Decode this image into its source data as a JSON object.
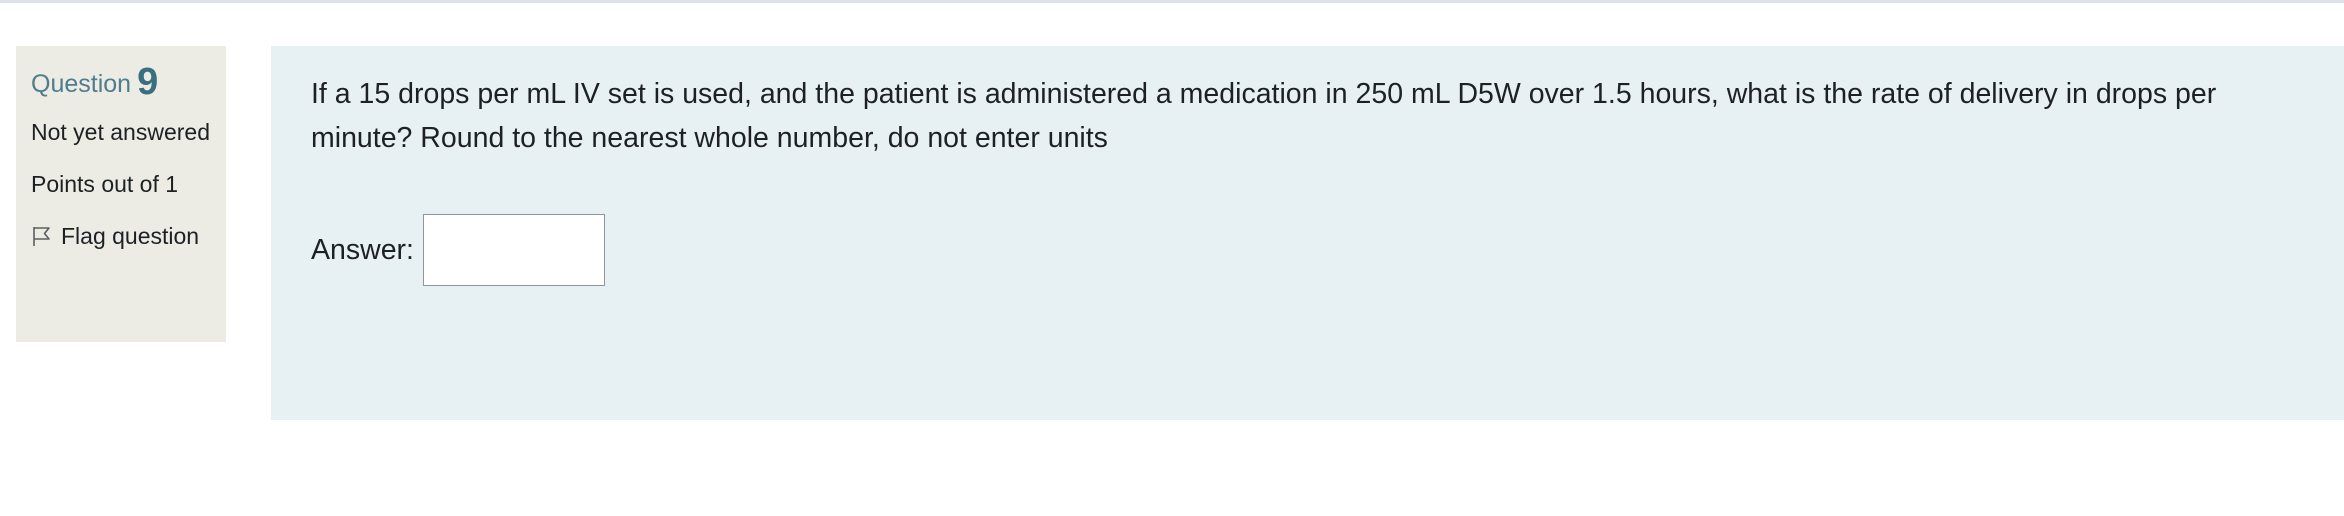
{
  "question_info": {
    "label": "Question",
    "number": "9",
    "state": "Not yet answered",
    "grade": "Points out of 1",
    "flag_label": "Flag question"
  },
  "question": {
    "text": "If a 15 drops per mL IV set is used, and the patient is administered a medication in 250 mL D5W over 1.5 hours, what is the rate of delivery in drops per minute? Round to the nearest whole number, do not enter units",
    "answer_label": "Answer:",
    "answer_value": ""
  },
  "colors": {
    "info_background": "#ecece4",
    "content_background": "#e7f0f2",
    "question_number": "#3a6f80",
    "question_word": "#4f7d8d",
    "text": "#1d2125"
  },
  "icons": {
    "flag": "flag-icon"
  }
}
